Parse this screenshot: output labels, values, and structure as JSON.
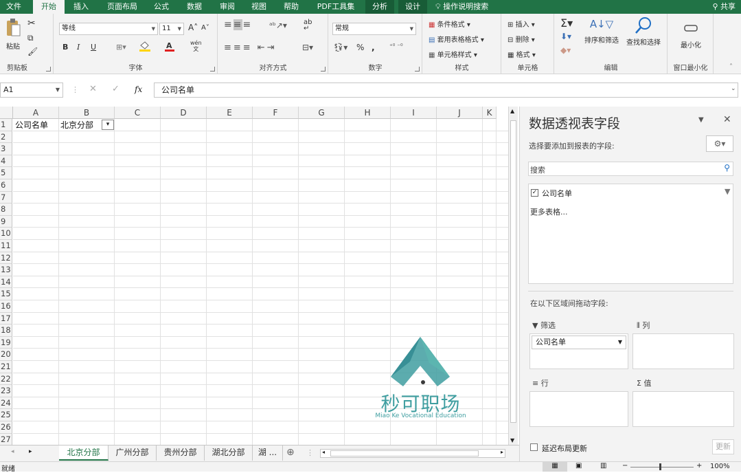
{
  "menu": {
    "tabs": [
      "文件",
      "开始",
      "插入",
      "页面布局",
      "公式",
      "数据",
      "审阅",
      "视图",
      "帮助",
      "PDF工具集",
      "分析",
      "设计",
      "操作说明搜索"
    ],
    "active": "开始",
    "share": "共享"
  },
  "ribbon": {
    "clipboard": {
      "paste": "粘贴",
      "label": "剪贴板"
    },
    "font": {
      "name": "等线",
      "size": "11",
      "bold": "B",
      "italic": "I",
      "underline": "U",
      "grow": "A",
      "shrink": "A",
      "phonetic": "wén",
      "label": "字体"
    },
    "alignment": {
      "wrap": "ab",
      "label": "对齐方式"
    },
    "number": {
      "format": "常规",
      "percent": "%",
      "comma": ",",
      "label": "数字"
    },
    "styles": {
      "conditional": "条件格式",
      "table": "套用表格格式",
      "cell": "单元格样式",
      "label": "样式"
    },
    "cells": {
      "insert": "插入",
      "delete": "删除",
      "format": "格式",
      "label": "单元格"
    },
    "editing": {
      "sort": "排序和筛选",
      "find": "查找和选择",
      "label": "编辑"
    },
    "window": {
      "minimize": "最小化",
      "label": "窗口最小化"
    }
  },
  "formula": {
    "namebox": "A1",
    "fx": "fx",
    "content": "公司名单"
  },
  "grid": {
    "columns": [
      "A",
      "B",
      "C",
      "D",
      "E",
      "F",
      "G",
      "H",
      "I",
      "J",
      "K"
    ],
    "rows": [
      "1",
      "2",
      "3",
      "4",
      "5",
      "6",
      "7",
      "8",
      "9",
      "10",
      "11",
      "12",
      "13",
      "14",
      "15",
      "16",
      "17",
      "18",
      "19",
      "20",
      "21",
      "22",
      "23",
      "24",
      "25",
      "26",
      "27"
    ],
    "a1": "公司名单",
    "b1": "北京分部"
  },
  "sheets": {
    "tabs": [
      "北京分部",
      "广州分部",
      "贵州分部",
      "湖北分部",
      "湖 ..."
    ],
    "active": "北京分部"
  },
  "status": {
    "ready": "就绪",
    "zoom": "100%"
  },
  "pivot": {
    "title": "数据透视表字段",
    "subtitle": "选择要添加到报表的字段:",
    "search_placeholder": "搜索",
    "field": "公司名单",
    "more_tables": "更多表格...",
    "drag_hint": "在以下区域间拖动字段:",
    "zones": {
      "filter": "筛选",
      "columns": "列",
      "rows": "行",
      "values": "值"
    },
    "filter_item": "公司名单",
    "defer": "延迟布局更新",
    "update": "更新"
  },
  "watermark": {
    "cn": "秒可职场",
    "en": "Miao Ke Vocational Education"
  },
  "colors": {
    "accent": "#217346",
    "watermark": "#3f9ea0"
  }
}
